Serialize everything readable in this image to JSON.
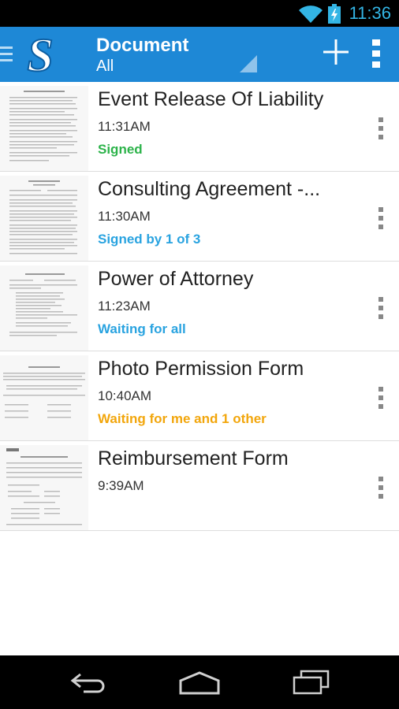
{
  "status_bar": {
    "time": "11:36",
    "icons": [
      "wifi-icon",
      "battery-charging-icon"
    ],
    "accent": "#33b5e5"
  },
  "app_bar": {
    "title": "Document",
    "filter": "All",
    "logo_letter": "S",
    "color": "#1e88d6",
    "icons": [
      "menu-icon",
      "add-icon",
      "overflow-menu-icon"
    ]
  },
  "documents": [
    {
      "title": "Event Release Of Liability",
      "time": "11:31AM",
      "status": "Signed",
      "status_color": "#2cb34a"
    },
    {
      "title": "Consulting Agreement -...",
      "time": "11:30AM",
      "status": "Signed by 1 of 3",
      "status_color": "#29a3e0"
    },
    {
      "title": "Power of Attorney",
      "time": "11:23AM",
      "status": "Waiting for all",
      "status_color": "#29a3e0"
    },
    {
      "title": "Photo Permission Form",
      "time": "10:40AM",
      "status": "Waiting for me and 1 other",
      "status_color": "#f2a60c"
    },
    {
      "title": "Reimbursement Form",
      "time": "9:39AM",
      "status": "",
      "status_color": "#29a3e0"
    }
  ],
  "nav_bar": {
    "icons": [
      "back-icon",
      "home-icon",
      "recent-apps-icon"
    ]
  }
}
